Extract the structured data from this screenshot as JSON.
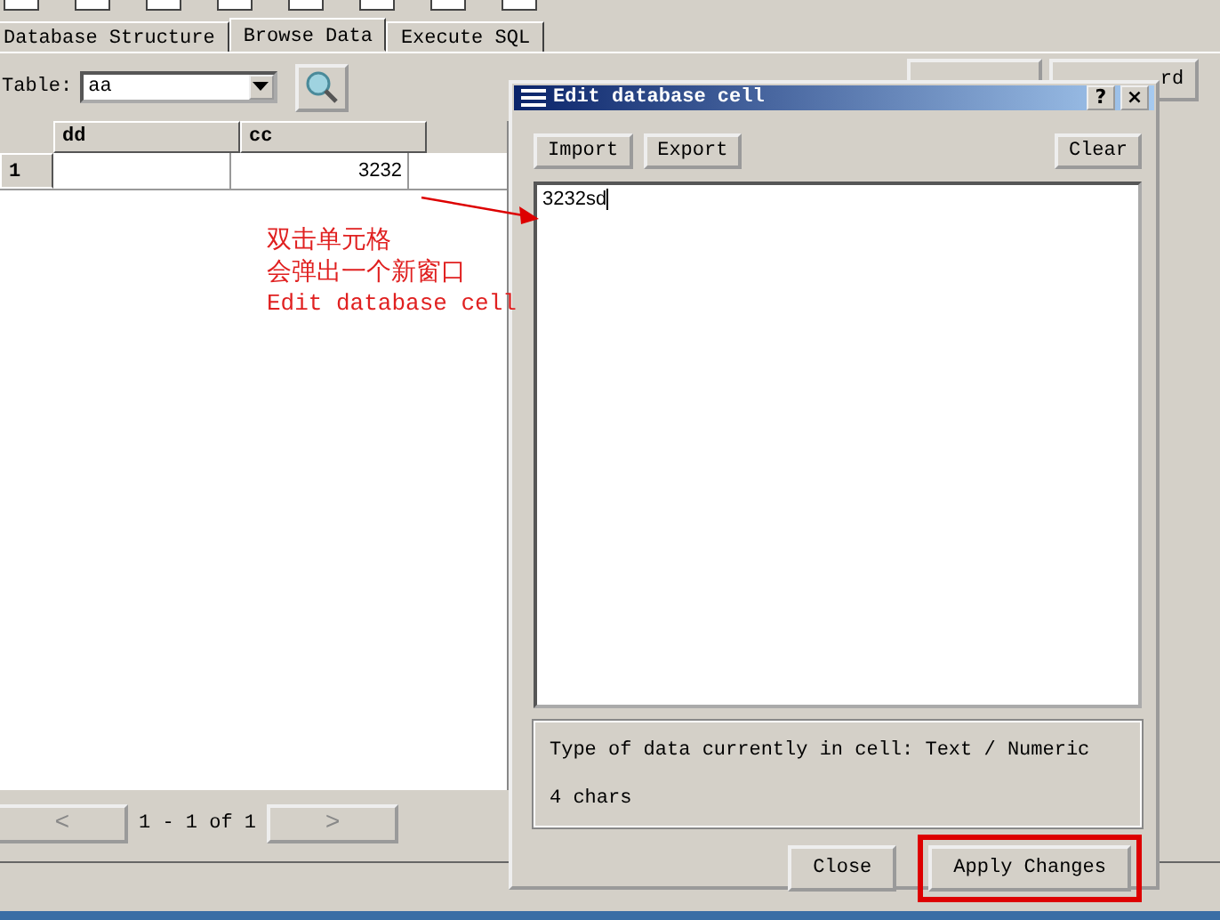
{
  "tabs": [
    {
      "label": "Database Structure",
      "selected": false
    },
    {
      "label": "Browse Data",
      "selected": true
    },
    {
      "label": "Execute SQL",
      "selected": false
    }
  ],
  "table_selector": {
    "label": "Table:",
    "value": "aa"
  },
  "background_button": {
    "label": "rd"
  },
  "grid": {
    "columns": [
      "dd",
      "cc"
    ],
    "rows": [
      {
        "number": "1",
        "cells": [
          "",
          "3232"
        ]
      }
    ]
  },
  "pagination": {
    "prev": "<",
    "range": "1 - 1 of 1",
    "next": ">"
  },
  "dialog": {
    "title": "Edit database cell",
    "help": "?",
    "close": "×",
    "buttons": [
      "Import",
      "Export"
    ],
    "clear": "Clear",
    "value": "3232sd",
    "info": [
      "Type of data currently in cell: Text / Numeric",
      "4 chars"
    ],
    "footer": [
      {
        "label": "Close",
        "highlighted": false
      },
      {
        "label": "Apply Changes",
        "highlighted": true
      }
    ]
  },
  "annotation": {
    "lines": [
      "双击单元格",
      "会弹出一个新窗口",
      "Edit database cell"
    ]
  }
}
